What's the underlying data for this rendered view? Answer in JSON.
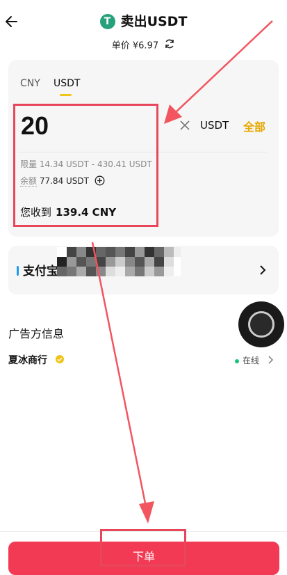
{
  "header": {
    "title": "卖出USDT",
    "price_label": "单价",
    "price_value": "¥6.97"
  },
  "trade_card": {
    "tabs": [
      {
        "label": "CNY",
        "active": false
      },
      {
        "label": "USDT",
        "active": true
      }
    ],
    "amount": "20",
    "unit": "USDT",
    "all_label": "全部",
    "limit_label": "限量",
    "limit_value": "14.34 USDT - 430.41 USDT",
    "balance_label": "余额",
    "balance_value": "77.84 USDT",
    "receive_label": "您收到",
    "receive_value": "139.4 CNY"
  },
  "payment": {
    "method_label": "支付宝"
  },
  "advertiser": {
    "section_title": "广告方信息",
    "merchant_name": "夏冰商行",
    "status": "在线"
  },
  "order_button": "下单",
  "colors": {
    "accent_yellow": "#f0c419",
    "order_red": "#f23a55",
    "annotation_red": "#e8465a",
    "tether_green": "#26a17b",
    "online_green": "#19c47a"
  }
}
